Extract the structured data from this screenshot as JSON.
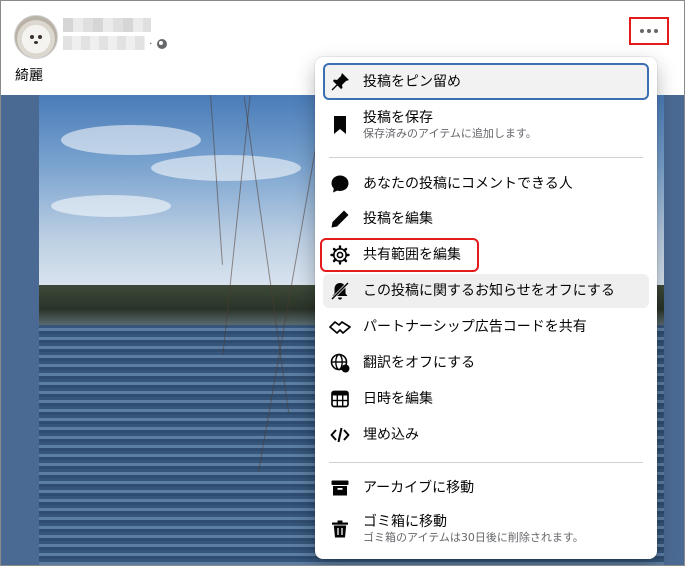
{
  "post": {
    "text": "綺麗",
    "meta_separator": "·"
  },
  "menu": {
    "items": [
      {
        "label": "投稿をピン留め",
        "icon": "pin-icon"
      },
      {
        "label": "投稿を保存",
        "sub": "保存済みのアイテムに追加します。",
        "icon": "bookmark-icon"
      },
      {
        "label": "あなたの投稿にコメントできる人",
        "icon": "comment-icon"
      },
      {
        "label": "投稿を編集",
        "icon": "pencil-icon"
      },
      {
        "label": "共有範囲を編集",
        "icon": "gear-icon"
      },
      {
        "label": "この投稿に関するお知らせをオフにする",
        "icon": "bell-off-icon"
      },
      {
        "label": "パートナーシップ広告コードを共有",
        "icon": "handshake-icon"
      },
      {
        "label": "翻訳をオフにする",
        "icon": "globe-icon"
      },
      {
        "label": "日時を編集",
        "icon": "calendar-icon"
      },
      {
        "label": "埋め込み",
        "icon": "code-icon"
      },
      {
        "label": "アーカイブに移動",
        "icon": "archive-icon"
      },
      {
        "label": "ゴミ箱に移動",
        "sub": "ゴミ箱のアイテムは30日後に削除されます。",
        "icon": "trash-icon"
      }
    ]
  },
  "colors": {
    "highlight_box": "#e41b1b",
    "focus_ring": "#3b6fb1",
    "text_primary": "#050505",
    "text_secondary": "#65676b"
  }
}
